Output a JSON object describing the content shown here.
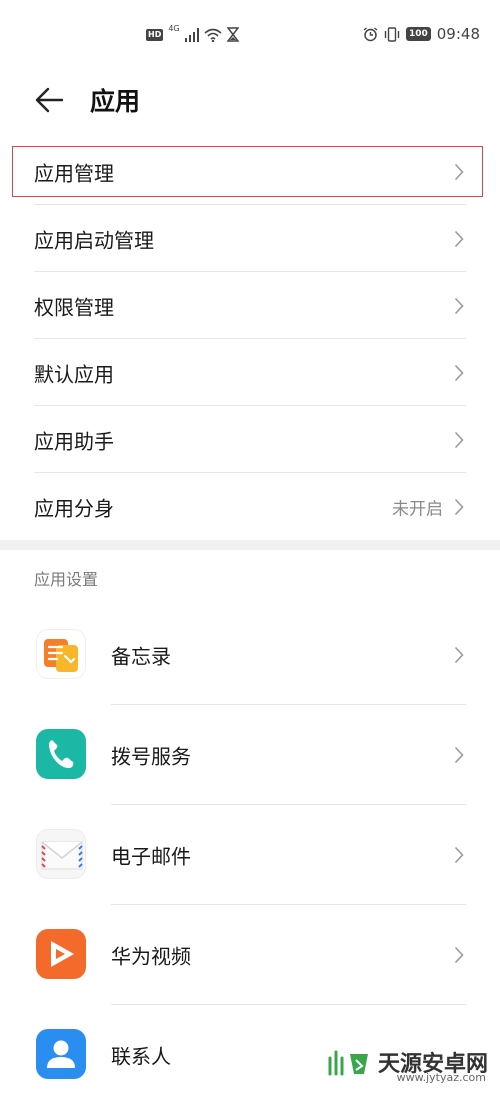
{
  "status_bar": {
    "hd_badge": "HD",
    "network": "4G",
    "battery": "100",
    "time": "09:48",
    "icons": [
      "hd-icon",
      "signal-icon",
      "wifi-icon",
      "hourglass-icon",
      "alarm-icon",
      "vibrate-icon",
      "battery-icon"
    ]
  },
  "header": {
    "title": "应用",
    "back_icon": "back-arrow-icon"
  },
  "menu": {
    "items": [
      {
        "label": "应用管理",
        "status": "",
        "highlighted": true
      },
      {
        "label": "应用启动管理",
        "status": ""
      },
      {
        "label": "权限管理",
        "status": ""
      },
      {
        "label": "默认应用",
        "status": ""
      },
      {
        "label": "应用助手",
        "status": ""
      },
      {
        "label": "应用分身",
        "status": "未开启"
      }
    ]
  },
  "section": {
    "header": "应用设置"
  },
  "apps": {
    "items": [
      {
        "label": "备忘录",
        "icon": "notes-app-icon",
        "color": "#f39a2c"
      },
      {
        "label": "拨号服务",
        "icon": "phone-app-icon",
        "color": "#1bb8a6"
      },
      {
        "label": "电子邮件",
        "icon": "email-app-icon",
        "color": "#f4f4f4"
      },
      {
        "label": "华为视频",
        "icon": "video-app-icon",
        "color": "#f46a2a"
      },
      {
        "label": "联系人",
        "icon": "contacts-app-icon",
        "color": "#2a8ef0"
      }
    ]
  },
  "watermark": {
    "text": "天源安卓网",
    "url": "www.jytyaz.com"
  },
  "colors": {
    "highlight_border": "#d9453f",
    "divider": "#e6e6e6",
    "secondary_text": "#8a8a8a"
  }
}
